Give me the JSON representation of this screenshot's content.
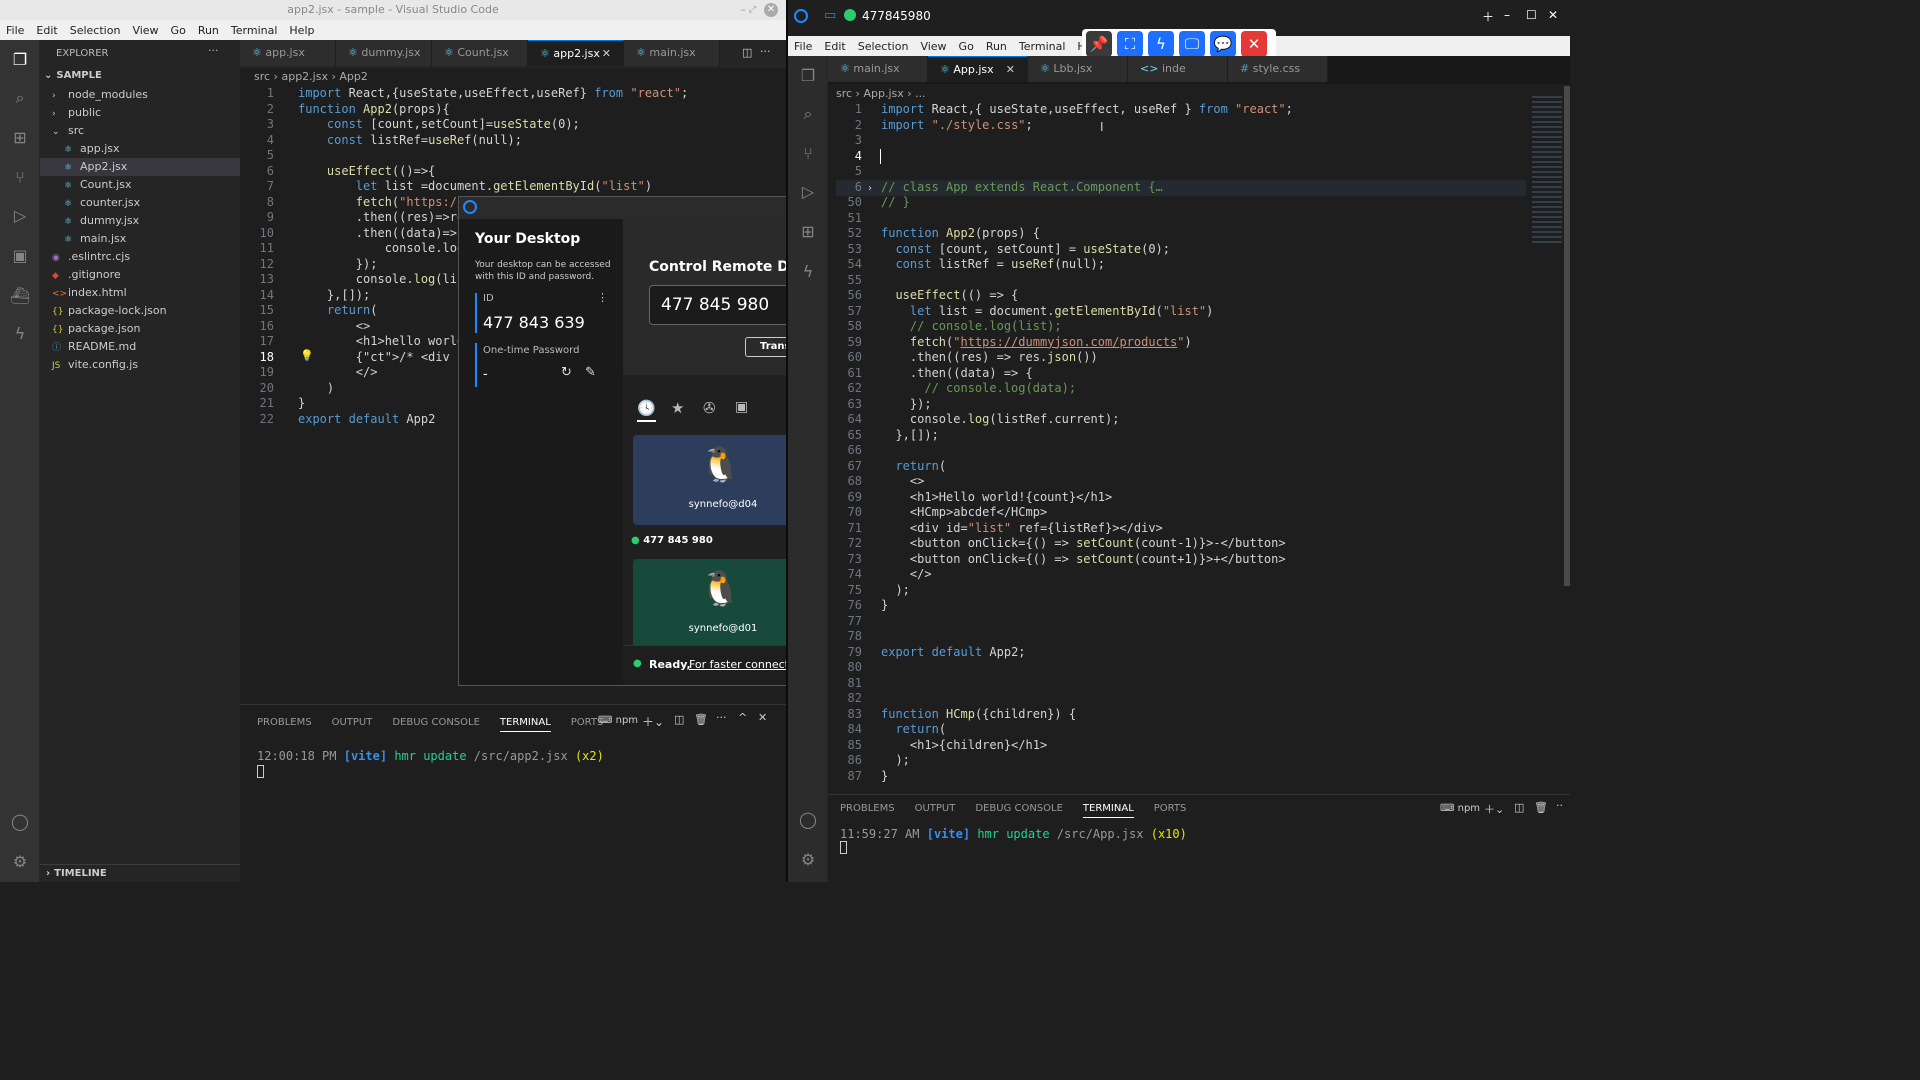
{
  "left": {
    "title": "app2.jsx - sample - Visual Studio Code",
    "menu": [
      "File",
      "Edit",
      "Selection",
      "View",
      "Go",
      "Run",
      "Terminal",
      "Help"
    ],
    "explorer": {
      "header": "EXPLORER",
      "root": "SAMPLE",
      "items": [
        {
          "label": "node_modules",
          "kind": "folder",
          "depth": 1
        },
        {
          "label": "public",
          "kind": "folder",
          "depth": 1
        },
        {
          "label": "src",
          "kind": "folder-open",
          "depth": 1
        },
        {
          "label": "app.jsx",
          "kind": "jsx",
          "depth": 2
        },
        {
          "label": "App2.jsx",
          "kind": "jsx",
          "depth": 2,
          "selected": true
        },
        {
          "label": "Count.jsx",
          "kind": "jsx",
          "depth": 2
        },
        {
          "label": "counter.jsx",
          "kind": "jsx",
          "depth": 2
        },
        {
          "label": "dummy.jsx",
          "kind": "jsx",
          "depth": 2
        },
        {
          "label": "main.jsx",
          "kind": "jsx",
          "depth": 2
        },
        {
          "label": ".eslintrc.cjs",
          "kind": "eslint",
          "depth": 1
        },
        {
          "label": ".gitignore",
          "kind": "git",
          "depth": 1
        },
        {
          "label": "index.html",
          "kind": "html",
          "depth": 1
        },
        {
          "label": "package-lock.json",
          "kind": "json",
          "depth": 1
        },
        {
          "label": "package.json",
          "kind": "json",
          "depth": 1
        },
        {
          "label": "README.md",
          "kind": "info",
          "depth": 1
        },
        {
          "label": "vite.config.js",
          "kind": "js",
          "depth": 1
        }
      ],
      "timeline": "TIMELINE"
    },
    "tabs": [
      "app.jsx",
      "dummy.jsx",
      "Count.jsx",
      "app2.jsx",
      "main.jsx"
    ],
    "active_tab": 3,
    "breadcrumb": [
      "src",
      "app2.jsx",
      "App2"
    ],
    "code": [
      "import React,{useState,useEffect,useRef} from \"react\";",
      "function App2(props){",
      "    const [count,setCount]=useState(0);",
      "    const listRef=useRef(null);",
      "",
      "    useEffect(()=>{",
      "        let list =document.getElementById(\"list\")",
      "        fetch(\"https://",
      "        .then((res)=>re",
      "        .then((data)=>{",
      "            console.log",
      "        });",
      "        console.log(lis",
      "    },[]);",
      "    return(",
      "        <>",
      "        <h1>hello world",
      "        {/* <div id=\"li",
      "        </>",
      "    )",
      "}",
      "export default App2"
    ],
    "panel": {
      "tabs": [
        "PROBLEMS",
        "OUTPUT",
        "DEBUG CONSOLE",
        "TERMINAL",
        "PORTS"
      ],
      "active": "TERMINAL",
      "shell": "npm",
      "line": {
        "time": "12:00:18 PM",
        "tag": "[vite]",
        "msg": "hmr update",
        "path": "/src/app2.jsx",
        "count": "(x2)"
      }
    }
  },
  "remote": {
    "your_desktop": "Your Desktop",
    "desc": "Your desktop can be accessed with this ID and password.",
    "id_label": "ID",
    "id_value": "477 843 639",
    "otp_label": "One-time Password",
    "otp_value": "-",
    "control_title": "Control Remote De",
    "remote_id": "477 845 980",
    "transfer": "Transfe",
    "cards": [
      {
        "name": "synnefo@d04",
        "color": "#2c3e5c"
      },
      {
        "name": "synnefo@d01",
        "color": "#184a3c"
      }
    ],
    "recent_id": "477 845 980",
    "status_ready": "Ready,",
    "status_link": "For faster connecti"
  },
  "right": {
    "title": "477845980",
    "menu": [
      "File",
      "Edit",
      "Selection",
      "View",
      "Go",
      "Run",
      "Terminal",
      "Help"
    ],
    "tabs": [
      "main.jsx",
      "App.jsx",
      "Lbb.jsx",
      "inde",
      "style.css"
    ],
    "active_tab": 1,
    "breadcrumb": [
      "src",
      "App.jsx",
      "..."
    ],
    "code": [
      {
        "n": "1",
        "t": "import React,{ useState,useEffect, useRef } from \"react\";"
      },
      {
        "n": "2",
        "t": "import \"./style.css\";"
      },
      {
        "n": "3",
        "t": ""
      },
      {
        "n": "4",
        "t": ""
      },
      {
        "n": "5",
        "t": ""
      },
      {
        "n": "6",
        "t": "// class App extends React.Component {…"
      },
      {
        "n": "50",
        "t": "// }"
      },
      {
        "n": "51",
        "t": ""
      },
      {
        "n": "52",
        "t": "function App2(props) {"
      },
      {
        "n": "53",
        "t": "  const [count, setCount] = useState(0);"
      },
      {
        "n": "54",
        "t": "  const listRef = useRef(null);"
      },
      {
        "n": "55",
        "t": ""
      },
      {
        "n": "56",
        "t": "  useEffect(() => {"
      },
      {
        "n": "57",
        "t": "    let list = document.getElementById(\"list\")"
      },
      {
        "n": "58",
        "t": "    // console.log(list);"
      },
      {
        "n": "59",
        "t": "    fetch(\"https://dummyjson.com/products\")"
      },
      {
        "n": "60",
        "t": "    .then((res) => res.json())"
      },
      {
        "n": "61",
        "t": "    .then((data) => {"
      },
      {
        "n": "62",
        "t": "      // console.log(data);"
      },
      {
        "n": "63",
        "t": "    });"
      },
      {
        "n": "64",
        "t": "    console.log(listRef.current);"
      },
      {
        "n": "65",
        "t": "  },[]);"
      },
      {
        "n": "66",
        "t": ""
      },
      {
        "n": "67",
        "t": "  return("
      },
      {
        "n": "68",
        "t": "    <>"
      },
      {
        "n": "69",
        "t": "    <h1>Hello world!{count}</h1>"
      },
      {
        "n": "70",
        "t": "    <HCmp>abcdef</HCmp>"
      },
      {
        "n": "71",
        "t": "    <div id=\"list\" ref={listRef}></div>"
      },
      {
        "n": "72",
        "t": "    <button onClick={() => setCount(count-1)}>-</button>"
      },
      {
        "n": "73",
        "t": "    <button onClick={() => setCount(count+1)}>+</button>"
      },
      {
        "n": "74",
        "t": "    </>"
      },
      {
        "n": "75",
        "t": "  );"
      },
      {
        "n": "76",
        "t": "}"
      },
      {
        "n": "77",
        "t": ""
      },
      {
        "n": "78",
        "t": ""
      },
      {
        "n": "79",
        "t": "export default App2;"
      },
      {
        "n": "80",
        "t": ""
      },
      {
        "n": "81",
        "t": ""
      },
      {
        "n": "82",
        "t": ""
      },
      {
        "n": "83",
        "t": "function HCmp({children}) {"
      },
      {
        "n": "84",
        "t": "  return("
      },
      {
        "n": "85",
        "t": "    <h1>{children}</h1>"
      },
      {
        "n": "86",
        "t": "  );"
      },
      {
        "n": "87",
        "t": "}"
      }
    ],
    "panel": {
      "tabs": [
        "PROBLEMS",
        "OUTPUT",
        "DEBUG CONSOLE",
        "TERMINAL",
        "PORTS"
      ],
      "active": "TERMINAL",
      "shell": "npm",
      "line": {
        "time": "11:59:27 AM",
        "tag": "[vite]",
        "msg": "hmr update",
        "path": "/src/App.jsx",
        "count": "(x10)"
      }
    },
    "toolbar": [
      "pin-icon",
      "fullscreen-icon",
      "lightning-icon",
      "monitor-icon",
      "chat-icon",
      "close-icon"
    ]
  }
}
